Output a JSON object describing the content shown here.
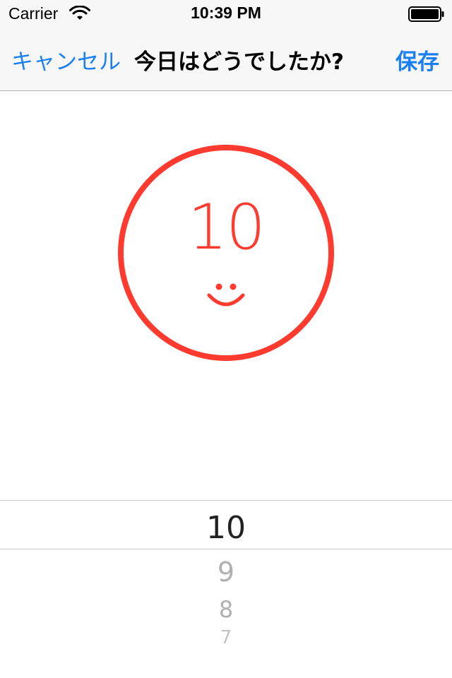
{
  "status_bar": {
    "carrier": "Carrier",
    "time": "10:39 PM"
  },
  "nav": {
    "cancel_label": "キャンセル",
    "title": "今日はどうでしたか?",
    "save_label": "保存"
  },
  "mood": {
    "value": "10",
    "face": "smile",
    "color": "#ff3b30"
  },
  "picker": {
    "selected": "10",
    "options_below": [
      "9",
      "8",
      "7"
    ]
  },
  "colors": {
    "accent": "#1a7ff5",
    "mood": "#ff3b30"
  }
}
